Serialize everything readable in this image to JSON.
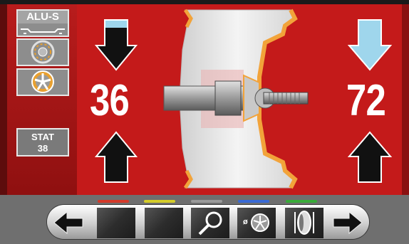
{
  "sidebar": {
    "mode_label": "ALU-S",
    "stat_label": "STAT",
    "stat_value": "38"
  },
  "readouts": {
    "left_value": "36",
    "right_value": "72"
  },
  "indicators": {
    "colors": [
      "#d43a2a",
      "#d4cc2a",
      "#9a9a9a",
      "#3a6ad4",
      "#3aaa3a"
    ]
  },
  "toolbar": {
    "diameter_symbol": "ø",
    "icons": [
      "arrow-left-icon",
      "blank-button",
      "blank-button",
      "magnifier-icon",
      "wheel-diameter-icon",
      "tire-width-icon",
      "arrow-right-icon"
    ]
  },
  "colors": {
    "background": "#c41a1a",
    "arrow_filled": "#9fd6ec",
    "rim_accent": "#f2a33a"
  }
}
